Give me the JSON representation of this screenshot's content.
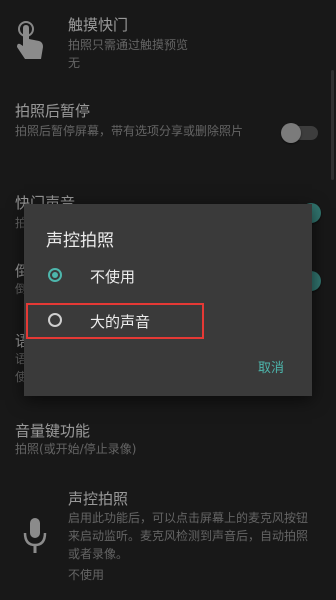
{
  "settings": {
    "touch_shutter": {
      "title": "触摸快门",
      "subtitle": "拍照只需通过触摸预览",
      "value": "无",
      "icon": "touch-hand-icon"
    },
    "pause_after": {
      "title": "拍照后暂停",
      "subtitle": "拍照后暂停屏幕，带有选项分享或删除照片",
      "toggle_on": false
    },
    "shutter_sound": {
      "title": "快门声音",
      "subtitle": "拍",
      "toggle_on": true
    },
    "partial_row_1": {
      "title": "倒",
      "subtitle": "倒"
    },
    "partial_row_2": {
      "title": "语",
      "subtitle_1": "语",
      "subtitle_2": "使"
    },
    "volume_key": {
      "title": "音量键功能",
      "subtitle": "拍照(或开始/停止录像)"
    },
    "voice_control": {
      "title": "声控拍照",
      "subtitle": "启用此功能后，可以点击屏幕上的麦克风按钮来启动监听。麦克风检测到声音后，自动拍照或者录像。",
      "value": "不使用",
      "icon": "microphone-icon"
    }
  },
  "dialog": {
    "title": "声控拍照",
    "options": [
      {
        "label": "不使用",
        "selected": true
      },
      {
        "label": "大的声音",
        "selected": false
      }
    ],
    "cancel_label": "取消"
  },
  "colors": {
    "accent": "#4db6ac",
    "highlight_box": "#e53935",
    "background": "#262626",
    "dialog": "#3a3a3a"
  }
}
